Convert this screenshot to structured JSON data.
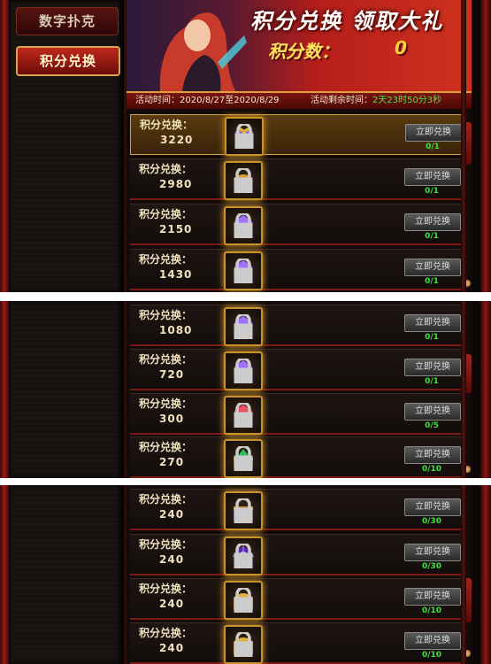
{
  "sidebar": {
    "item1": "数字扑克",
    "item2": "积分兑换"
  },
  "banner": {
    "title": "积分兑换 领取大礼",
    "score_label": "积分数：",
    "score_value": "0"
  },
  "timebar": {
    "period": "活动时间：2020/8/27至2020/8/29",
    "remaining_label": "活动剩余时间：",
    "remaining_value": "2天23时50分3秒"
  },
  "item_label": "积分兑换：",
  "button_label": "立即兑换",
  "panel1_items": [
    {
      "cost": "3220",
      "count": "0/1",
      "icon": "gift-box-icon"
    },
    {
      "cost": "2980",
      "count": "0/1",
      "icon": "treasure-pot-icon"
    },
    {
      "cost": "2150",
      "count": "0/1",
      "icon": "purple-gem-icon"
    },
    {
      "cost": "1430",
      "count": "0/1",
      "icon": "purple-gem-icon"
    }
  ],
  "panel2_items": [
    {
      "cost": "1080",
      "count": "0/1",
      "icon": "purple-gem-icon"
    },
    {
      "cost": "720",
      "count": "0/1",
      "icon": "purple-gem-icon"
    },
    {
      "cost": "300",
      "count": "0/5",
      "icon": "red-gem-icon"
    },
    {
      "cost": "270",
      "count": "0/10",
      "icon": "green-gem-chest-icon"
    }
  ],
  "panel3_items": [
    {
      "cost": "240",
      "count": "0/30",
      "icon": "gem-chest-icon"
    },
    {
      "cost": "240",
      "count": "0/30",
      "icon": "purple-orb-icon"
    },
    {
      "cost": "240",
      "count": "0/10",
      "icon": "gold-chest-icon"
    },
    {
      "cost": "240",
      "count": "0/10",
      "icon": "gold-chest-icon"
    }
  ]
}
